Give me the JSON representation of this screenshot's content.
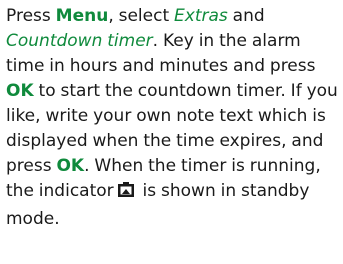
{
  "doc": {
    "t1": "Press ",
    "menu": "Menu",
    "t2": ", select ",
    "extras": "Extras",
    "t3": " and ",
    "countdown": "Countdown timer",
    "t4": ". Key in the alarm time in hours and minutes and press ",
    "ok1": "OK",
    "t5": " to start the countdown timer. If you like, write your own note text which is displayed when the time expires, and press ",
    "ok2": "OK",
    "t6": ". When the timer is running, the indicator",
    "t7": " is shown in standby mode."
  },
  "icons": {
    "indicator": "countdown-timer-indicator-icon"
  },
  "colors": {
    "keyword": "#0f8a3c",
    "text": "#1a1a1a"
  }
}
